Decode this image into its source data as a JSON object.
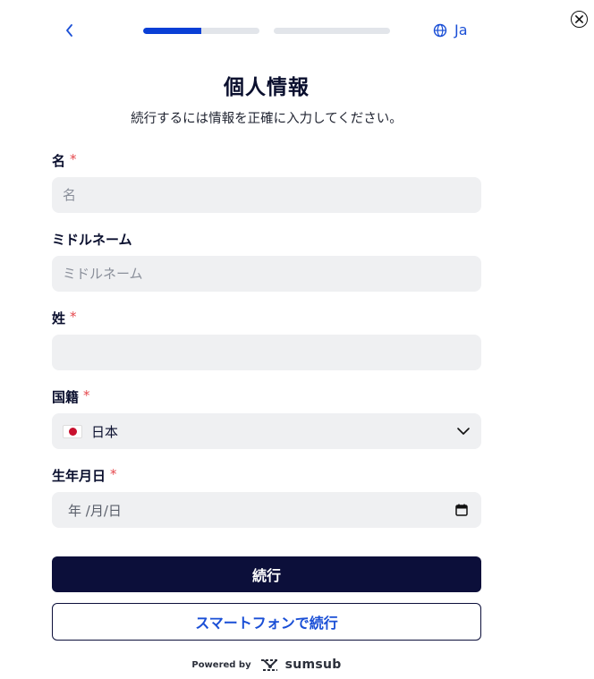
{
  "header": {
    "progress": [
      0.5,
      0.0
    ],
    "language": "Ja"
  },
  "page": {
    "title": "個人情報",
    "subtitle": "続行するには情報を正確に入力してください。"
  },
  "form": {
    "first_name": {
      "label": "名",
      "required_mark": "*",
      "placeholder": "名",
      "value": ""
    },
    "middle_name": {
      "label": "ミドルネーム",
      "placeholder": "ミドルネーム",
      "value": ""
    },
    "last_name": {
      "label": "姓",
      "required_mark": "*",
      "placeholder": "",
      "value": ""
    },
    "nationality": {
      "label": "国籍",
      "required_mark": "*",
      "value": "日本",
      "flag_icon": "japan-flag-icon"
    },
    "birth_date": {
      "label": "生年月日",
      "required_mark": "*",
      "placeholder": "年 /月/日"
    }
  },
  "actions": {
    "continue_label": "続行",
    "continue_phone_label": "スマートフォンで続行"
  },
  "footer": {
    "powered_by": "Powered by",
    "brand": "sumsub"
  },
  "colors": {
    "accent": "#1a4fd6",
    "primary_button": "#0c0f3a",
    "required": "#e5484d",
    "input_bg": "#eff0f2"
  }
}
